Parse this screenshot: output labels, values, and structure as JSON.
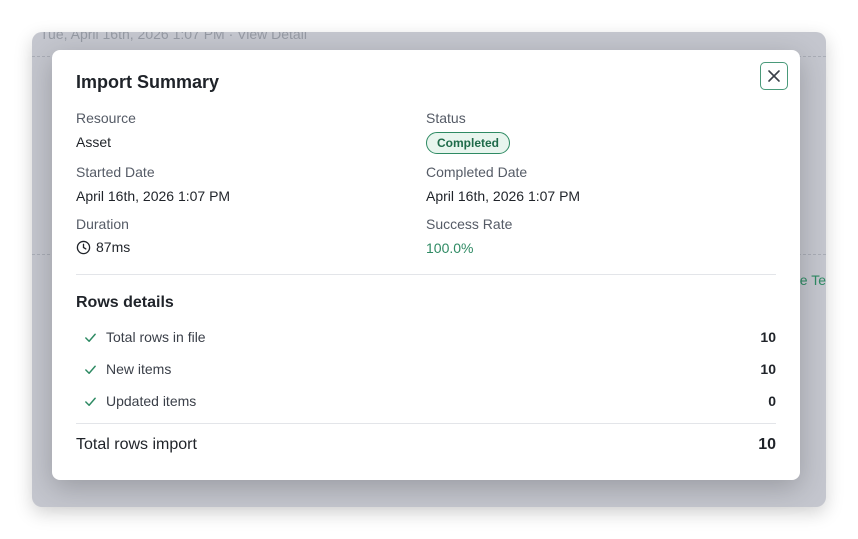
{
  "background": {
    "strip_text": "Tue, April 16th, 2026 1:07 PM · View Detail",
    "link_text": "e Te"
  },
  "modal": {
    "title": "Import Summary",
    "close_icon": "close-icon",
    "fields": {
      "resource_label": "Resource",
      "resource_value": "Asset",
      "status_label": "Status",
      "status_value": "Completed",
      "started_label": "Started Date",
      "started_value": "April 16th, 2026 1:07 PM",
      "completed_label": "Completed Date",
      "completed_value": "April 16th, 2026 1:07 PM",
      "duration_label": "Duration",
      "duration_value": "87ms",
      "success_label": "Success Rate",
      "success_value": "100.0%"
    },
    "rows_details": {
      "title": "Rows details",
      "items": [
        {
          "label": "Total rows in file",
          "value": "10"
        },
        {
          "label": "New items",
          "value": "10"
        },
        {
          "label": "Updated items",
          "value": "0"
        }
      ],
      "total_label": "Total rows import",
      "total_value": "10"
    }
  },
  "colors": {
    "accent": "#2e8a63",
    "badge_bg": "#e8f5ee",
    "backdrop": "#c4c6ce"
  }
}
